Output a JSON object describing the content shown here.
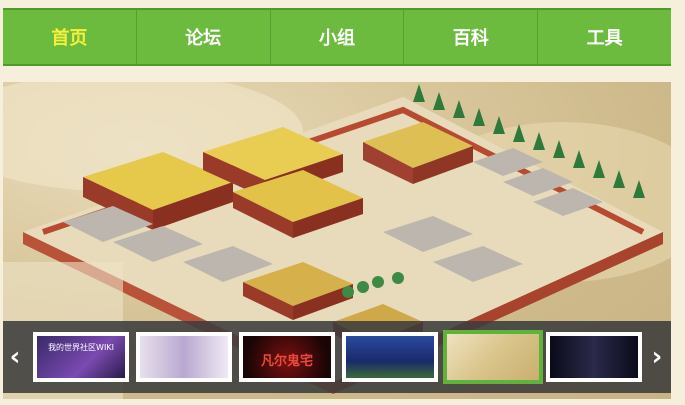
{
  "nav": {
    "items": [
      {
        "label": "首页",
        "active": true
      },
      {
        "label": "论坛",
        "active": false
      },
      {
        "label": "小组",
        "active": false
      },
      {
        "label": "百科",
        "active": false
      },
      {
        "label": "工具",
        "active": false
      }
    ]
  },
  "carousel": {
    "prev_icon": "chevron-left-icon",
    "next_icon": "chevron-right-icon",
    "selected_index": 4,
    "thumbnails": [
      {
        "caption": "我的世界社区WIKI",
        "color": "#5a3a8a"
      },
      {
        "caption": "",
        "color": "#c8c0d8"
      },
      {
        "caption": "凡尔鬼宅",
        "color": "#3a0a0a"
      },
      {
        "caption": "",
        "color": "#1a2a6a"
      },
      {
        "caption": "",
        "color": "#d9c896"
      },
      {
        "caption": "",
        "color": "#1a1a2a"
      }
    ]
  },
  "colors": {
    "nav_green": "#6cba3e",
    "nav_active_text": "#f6f03a",
    "selected_border": "#5fb33a"
  }
}
